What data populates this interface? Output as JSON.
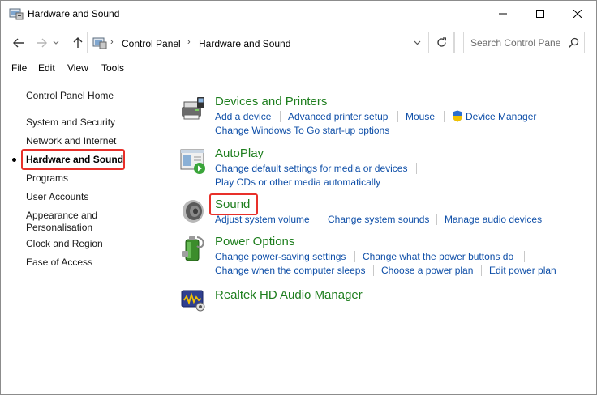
{
  "window": {
    "title": "Hardware and Sound",
    "icon": "control-panel-icon",
    "controls": [
      "minimize-icon",
      "maximize-icon",
      "close-icon"
    ]
  },
  "nav": {
    "back_icon": "arrow-left-icon",
    "forward_icon": "arrow-right-icon",
    "up_icon": "arrow-up-icon",
    "refresh_icon": "refresh-icon",
    "breadcrumbs": [
      "Control Panel",
      "Hardware and Sound"
    ],
    "search_placeholder": "Search Control Panel"
  },
  "menubar": [
    "File",
    "Edit",
    "View",
    "Tools"
  ],
  "sidebar": {
    "items": [
      {
        "label": "Control Panel Home"
      },
      {
        "label": "System and Security"
      },
      {
        "label": "Network and Internet"
      },
      {
        "label": "Hardware and Sound",
        "active": true
      },
      {
        "label": "Programs"
      },
      {
        "label": "User Accounts"
      },
      {
        "label": "Appearance and",
        "label2": "Personalisation"
      },
      {
        "label": "Clock and Region"
      },
      {
        "label": "Ease of Access"
      }
    ]
  },
  "categories": [
    {
      "title": "Devices and Printers",
      "icon": "devices-printers-icon",
      "row1": [
        "Add a device",
        "Advanced printer setup",
        "Mouse",
        "Device Manager"
      ],
      "row1_shield_icon": "uac-shield-icon",
      "row2": [
        "Change Windows To Go start-up options"
      ]
    },
    {
      "title": "AutoPlay",
      "icon": "autoplay-icon",
      "row1": [
        "Change default settings for media or devices"
      ],
      "row2": [
        "Play CDs or other media automatically"
      ]
    },
    {
      "title": "Sound",
      "icon": "speaker-icon",
      "row1": [
        "Adjust system volume",
        "Change system sounds",
        "Manage audio devices"
      ]
    },
    {
      "title": "Power Options",
      "icon": "battery-power-icon",
      "row1": [
        "Change power-saving settings",
        "Change what the power buttons do"
      ],
      "row2": [
        "Change when the computer sleeps",
        "Choose a power plan",
        "Edit power plan"
      ]
    },
    {
      "title": "Realtek HD Audio Manager",
      "icon": "realtek-audio-icon"
    }
  ],
  "colors": {
    "highlight_box": "#e8302a",
    "category_title": "#1e7e1e",
    "link": "#0f4fa8"
  }
}
